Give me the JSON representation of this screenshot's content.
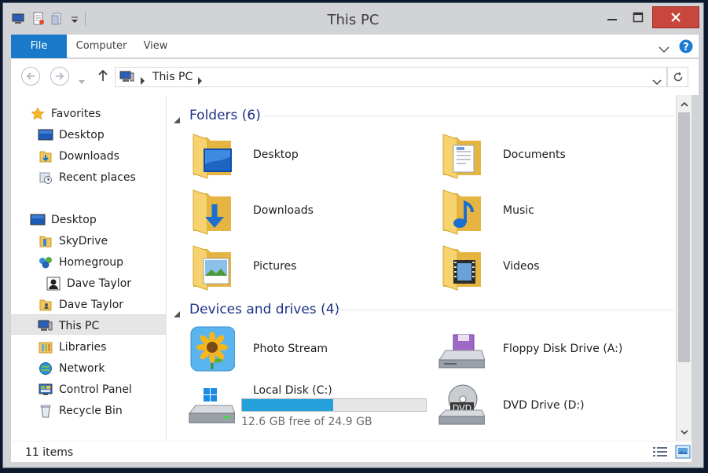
{
  "window": {
    "title": "This PC",
    "buttons": {
      "minimize": "minimize",
      "maximize": "maximize",
      "close": "close"
    }
  },
  "ribbon": {
    "tabs": [
      {
        "label": "File",
        "active": true
      },
      {
        "label": "Computer"
      },
      {
        "label": "View"
      }
    ]
  },
  "address": {
    "path": "This PC"
  },
  "nav": {
    "items": [
      {
        "label": "Favorites",
        "icon": "star-icon"
      },
      {
        "label": "Desktop",
        "icon": "desktop-icon"
      },
      {
        "label": "Downloads",
        "icon": "downloads-folder-icon"
      },
      {
        "label": "Recent places",
        "icon": "recent-places-icon"
      },
      {
        "label": "Desktop",
        "icon": "desktop-icon"
      },
      {
        "label": "SkyDrive",
        "icon": "skydrive-folder-icon"
      },
      {
        "label": "Homegroup",
        "icon": "homegroup-icon"
      },
      {
        "label": "Dave Taylor",
        "icon": "user-avatar-icon"
      },
      {
        "label": "Dave Taylor",
        "icon": "user-folder-icon"
      },
      {
        "label": "This PC",
        "icon": "computer-icon",
        "selected": true
      },
      {
        "label": "Libraries",
        "icon": "libraries-icon"
      },
      {
        "label": "Network",
        "icon": "network-icon"
      },
      {
        "label": "Control Panel",
        "icon": "control-panel-icon"
      },
      {
        "label": "Recycle Bin",
        "icon": "recycle-bin-icon"
      }
    ]
  },
  "content": {
    "folders_header": "Folders (6)",
    "folders": [
      {
        "label": "Desktop",
        "icon": "desktop-folder-icon"
      },
      {
        "label": "Documents",
        "icon": "documents-folder-icon"
      },
      {
        "label": "Downloads",
        "icon": "downloads-folder-icon"
      },
      {
        "label": "Music",
        "icon": "music-folder-icon"
      },
      {
        "label": "Pictures",
        "icon": "pictures-folder-icon"
      },
      {
        "label": "Videos",
        "icon": "videos-folder-icon"
      }
    ],
    "devices_header": "Devices and drives (4)",
    "devices": [
      {
        "label": "Photo Stream",
        "icon": "photo-stream-icon"
      },
      {
        "label": "Floppy Disk Drive (A:)",
        "icon": "floppy-drive-icon"
      },
      {
        "label": "Local Disk (C:)",
        "icon": "local-disk-icon",
        "free_text": "12.6 GB free of 24.9 GB",
        "used_fraction": 0.494
      },
      {
        "label": "DVD Drive (D:)",
        "icon": "dvd-drive-icon",
        "disc_label": "DVD"
      }
    ]
  },
  "status": {
    "item_count": "11 items"
  },
  "colors": {
    "accent": "#1979ca",
    "close_button": "#c7473c",
    "group_header": "#1e3287",
    "progress": "#26a0da",
    "folder": "#f1c75a"
  }
}
